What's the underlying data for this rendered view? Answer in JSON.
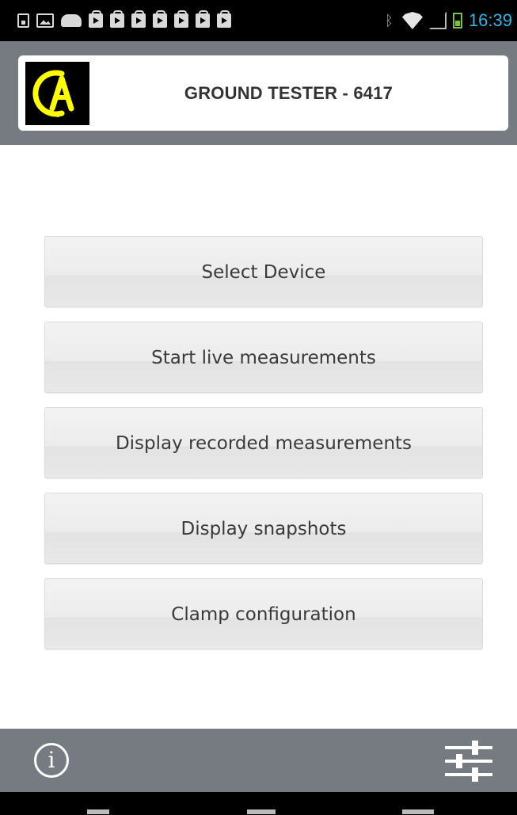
{
  "status_bar": {
    "time": "16:39",
    "icons": [
      "sdcard-icon",
      "picture-icon",
      "android-icon",
      "play-store-icon",
      "play-store-icon",
      "play-store-icon",
      "play-store-icon",
      "play-store-icon",
      "play-store-icon",
      "play-store-icon",
      "bluetooth-icon",
      "wifi-icon",
      "signal-icon",
      "battery-icon"
    ],
    "accent": "#33b5e5"
  },
  "header": {
    "title": "GROUND TESTER - 6417",
    "logo_text": "CA",
    "logo_color": "#ffff00",
    "bar_color": "#757b80"
  },
  "menu": {
    "items": [
      {
        "label": "Select Device"
      },
      {
        "label": "Start live measurements"
      },
      {
        "label": "Display recorded measurements"
      },
      {
        "label": "Display snapshots"
      },
      {
        "label": "Clamp configuration"
      }
    ]
  },
  "toolbar": {
    "info_icon": "info-icon",
    "info_label": "i",
    "settings_icon": "settings-sliders-icon"
  }
}
